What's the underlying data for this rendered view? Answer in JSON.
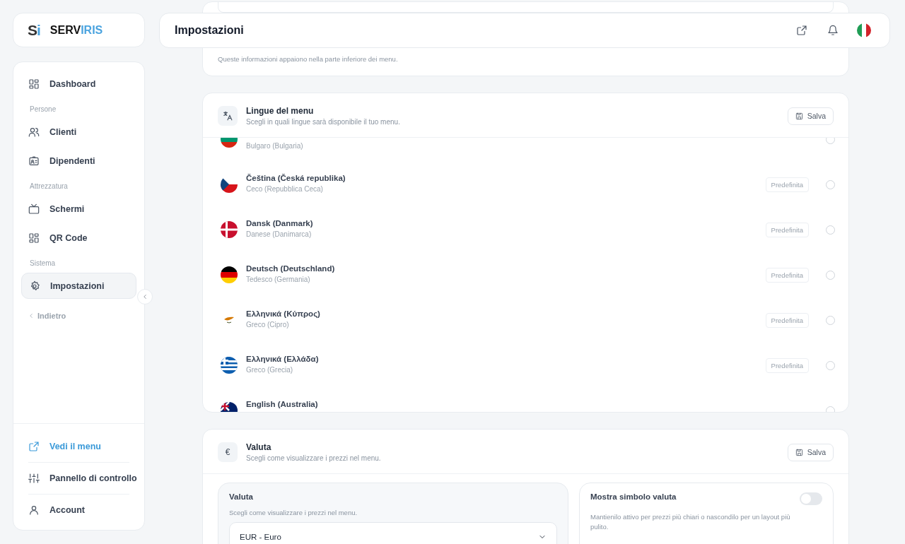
{
  "brand": {
    "mark_dark": "S",
    "mark_light": "i",
    "name_dark": "SERV",
    "name_light": "IRIS"
  },
  "header": {
    "title": "Impostazioni"
  },
  "sidebar": {
    "items": [
      {
        "kind": "link",
        "label": "Dashboard",
        "selected": false
      },
      {
        "kind": "section",
        "label": "Persone"
      },
      {
        "kind": "link",
        "label": "Clienti",
        "selected": false
      },
      {
        "kind": "link",
        "label": "Dipendenti",
        "selected": false
      },
      {
        "kind": "section",
        "label": "Attrezzatura"
      },
      {
        "kind": "link",
        "label": "Schermi",
        "selected": false
      },
      {
        "kind": "link",
        "label": "QR Code",
        "selected": false
      },
      {
        "kind": "section",
        "label": "Sistema"
      },
      {
        "kind": "link",
        "label": "Impostazioni",
        "selected": true
      },
      {
        "kind": "back",
        "label": "Indietro"
      }
    ],
    "footer": [
      {
        "label": "Vedi il menu",
        "accent": true
      },
      {
        "label": "Pannello di controllo",
        "accent": false
      },
      {
        "label": "Account",
        "accent": false
      }
    ]
  },
  "info_card": {
    "hint": "Queste informazioni appaiono nella parte inferiore dei menu."
  },
  "languages_card": {
    "title": "Lingue del menu",
    "subtitle": "Scegli in quali lingue sarà disponibile il tuo menu.",
    "save": "Salva",
    "rows": [
      {
        "subtitle": "Bulgaro (Bulgaria)",
        "selected": false
      },
      {
        "name": "Čeština (Česká republika)",
        "subtitle": "Ceco (Repubblica Ceca)",
        "default_label": "Predefinita",
        "selected": false
      },
      {
        "name": "Dansk (Danmark)",
        "subtitle": "Danese (Danimarca)",
        "default_label": "Predefinita",
        "selected": false
      },
      {
        "name": "Deutsch (Deutschland)",
        "subtitle": "Tedesco (Germania)",
        "default_label": "Predefinita",
        "selected": false
      },
      {
        "name": "Ελληνικά (Κύπρος)",
        "subtitle": "Greco (Cipro)",
        "default_label": "Predefinita",
        "selected": false
      },
      {
        "name": "Ελληνικά (Ελλάδα)",
        "subtitle": "Greco (Grecia)",
        "default_label": "Predefinita",
        "selected": false
      },
      {
        "name": "English (Australia)",
        "selected": false
      }
    ]
  },
  "currency_card": {
    "icon_text": "€",
    "title": "Valuta",
    "subtitle": "Scegli come visualizzare i prezzi nel menu.",
    "save": "Salva",
    "select_panel": {
      "title": "Valuta",
      "hint": "Scegli come visualizzare i prezzi nel menu.",
      "value": "EUR - Euro"
    },
    "toggle_panel": {
      "title": "Mostra simbolo valuta",
      "description": "Mantienilo attivo per prezzi più chiari o nascondilo per un layout più pulito.",
      "on": false
    }
  }
}
